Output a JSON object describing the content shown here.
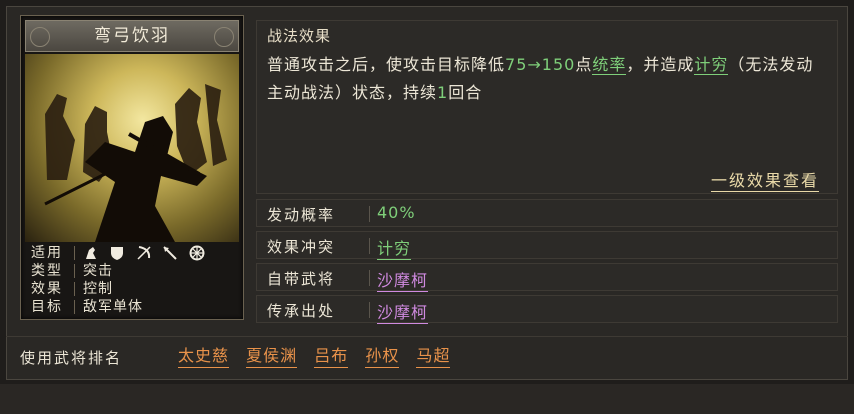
{
  "skill": {
    "name": "弯弓饮羽",
    "info": {
      "apply_label": "适用",
      "apply_icons": [
        "cavalry-icon",
        "shield-icon",
        "bow-icon",
        "spear-icon",
        "wheel-icon"
      ],
      "type_label": "类型",
      "type_value": "突击",
      "effect_label": "效果",
      "effect_value": "控制",
      "target_label": "目标",
      "target_value": "敌军单体"
    }
  },
  "effect": {
    "title": "战法效果",
    "desc_p1": "普通攻击之后，使攻击目标降低",
    "desc_range": "75→150",
    "desc_p2": "点",
    "desc_stat": "统率",
    "desc_p3": "，并造成",
    "desc_state": "计穷",
    "desc_p4": "（无法发动主动战法）状态，持续",
    "desc_turns": "1",
    "desc_p5": "回合",
    "level_link": "一级效果查看"
  },
  "stats": [
    {
      "label": "发动概率",
      "value": "40%"
    },
    {
      "label": "效果冲突",
      "value": "计穷"
    },
    {
      "label": "自带武将",
      "value": "沙摩柯"
    },
    {
      "label": "传承出处",
      "value": "沙摩柯"
    }
  ],
  "rank": {
    "label": "使用武将排名",
    "names": [
      "太史慈",
      "夏侯渊",
      "吕布",
      "孙权",
      "马超"
    ]
  },
  "colors": {
    "green": "#7fcf7a",
    "purple": "#d08ae0",
    "orange": "#e8924a",
    "gold": "#e9d9a8"
  }
}
